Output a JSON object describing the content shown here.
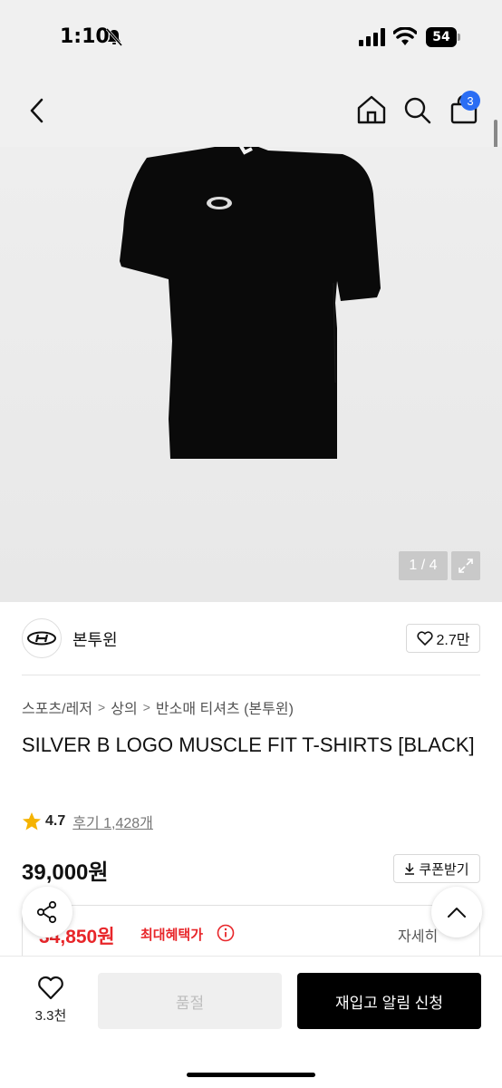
{
  "status_bar": {
    "time": "1:10",
    "battery": "54"
  },
  "header": {
    "cart_count": "3"
  },
  "gallery": {
    "counter": "1 / 4"
  },
  "brand": {
    "name": "본투윈",
    "likes": "2.7만"
  },
  "breadcrumb": [
    "스포츠/레저",
    "상의",
    "반소매 티셔츠 (본투윈)"
  ],
  "product": {
    "title": "SILVER B LOGO MUSCLE FIT T-SHIRTS [BLACK]",
    "rating": "4.7",
    "reviews": "후기 1,428개",
    "price": "39,000원",
    "coupon_label": "쿠폰받기"
  },
  "benefit": {
    "price": "34,850원",
    "label": "최대혜택가",
    "detail": "자세히"
  },
  "bottom_bar": {
    "wish_count": "3.3천",
    "soldout_label": "품절",
    "restock_label": "재입고 알림 신청"
  },
  "colors": {
    "accent_red": "#e8262a",
    "badge_blue": "#2a6df4",
    "star": "#f5b301"
  },
  "icons": [
    "bell-slash-icon",
    "signal-icon",
    "wifi-icon",
    "back-icon",
    "home-icon",
    "search-icon",
    "cart-icon",
    "expand-icon",
    "heart-icon",
    "star-icon",
    "download-icon",
    "info-icon",
    "share-icon",
    "chevron-up-icon"
  ]
}
